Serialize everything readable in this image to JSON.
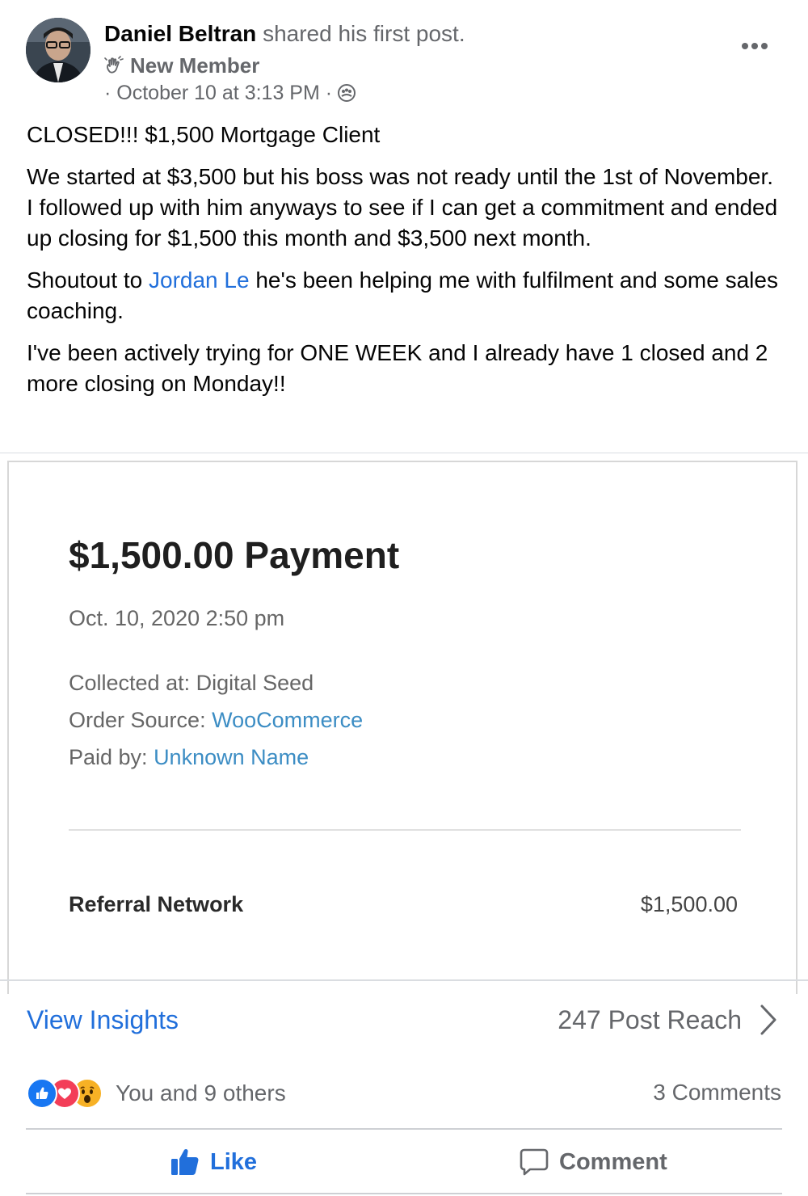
{
  "post": {
    "author_name": "Daniel Beltran",
    "author_action": "shared his first post.",
    "badge_icon": "wave-hand-icon",
    "badge_label": "New Member",
    "timestamp": "· October 10 at 3:13 PM ·",
    "privacy_icon": "group-icon",
    "more_label": "•••",
    "title": "CLOSED!!! $1,500 Mortgage Client",
    "paragraph_1": "We started at $3,500 but his boss was not ready until the 1st of November. I followed up with him anyways to see if I can get a commitment and ended up closing for $1,500 this month and $3,500 next month.",
    "paragraph_2_before": "Shoutout to ",
    "paragraph_2_mention": "Jordan Le",
    "paragraph_2_after": " he's been helping me with fulfilment and some sales coaching.",
    "paragraph_3": "I've been actively trying for ONE WEEK and I already have 1 closed and 2 more closing on Monday!!"
  },
  "attachment": {
    "title": "$1,500.00 Payment",
    "date": "Oct. 10, 2020 2:50 pm",
    "collected_label": "Collected at: ",
    "collected_value": "Digital Seed",
    "source_label": "Order Source: ",
    "source_value": "WooCommerce",
    "paid_label": "Paid by: ",
    "paid_value": "Unknown Name",
    "item_label": "Referral Network",
    "item_amount": "$1,500.00"
  },
  "insights": {
    "link_label": "View Insights",
    "reach_label": "247 Post Reach"
  },
  "engagement": {
    "reactions": [
      "like-reaction-icon",
      "love-reaction-icon",
      "wow-reaction-icon"
    ],
    "reactions_text": "You and 9 others",
    "comments_text": "3 Comments"
  },
  "actions": {
    "like_label": "Like",
    "comment_label": "Comment"
  },
  "colors": {
    "link_blue": "#216fdb",
    "secondary_text": "#65676b",
    "love_red": "#f33e58",
    "wow_yellow": "#f7b125"
  }
}
